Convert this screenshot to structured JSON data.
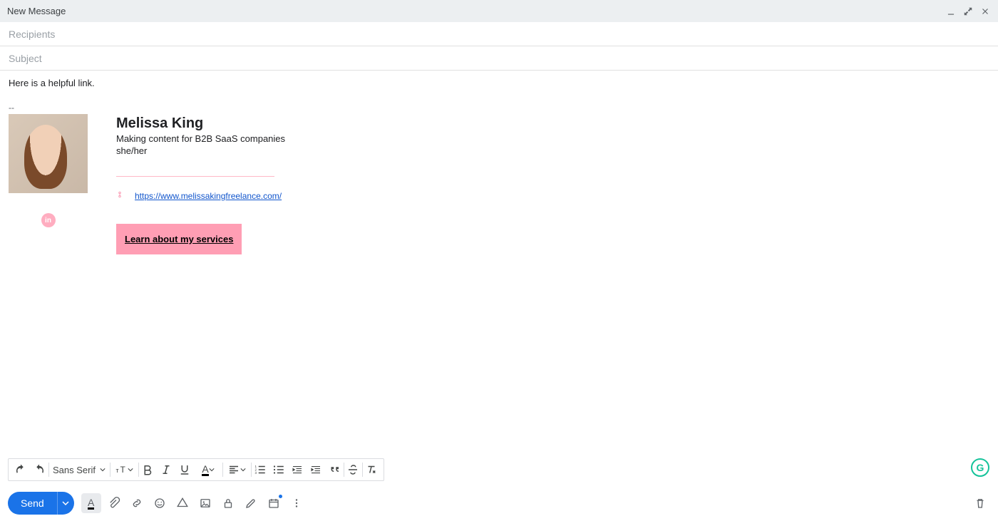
{
  "window": {
    "title": "New Message"
  },
  "fields": {
    "recipients_placeholder": "Recipients",
    "recipients_value": "",
    "subject_placeholder": "Subject",
    "subject_value": ""
  },
  "body": {
    "text": "Here is a helpful link.",
    "separator": "--"
  },
  "signature": {
    "name": "Melissa King",
    "tagline": "Making content for B2B SaaS companies",
    "pronouns": "she/her",
    "website_url": "https://www.melissakingfreelance.com/",
    "cta_label": "Learn about my services",
    "social_label": "in"
  },
  "format_toolbar": {
    "font_label": "Sans Serif"
  },
  "send": {
    "label": "Send"
  },
  "icons": {
    "text_color_letter": "A",
    "grammarly": "G"
  }
}
